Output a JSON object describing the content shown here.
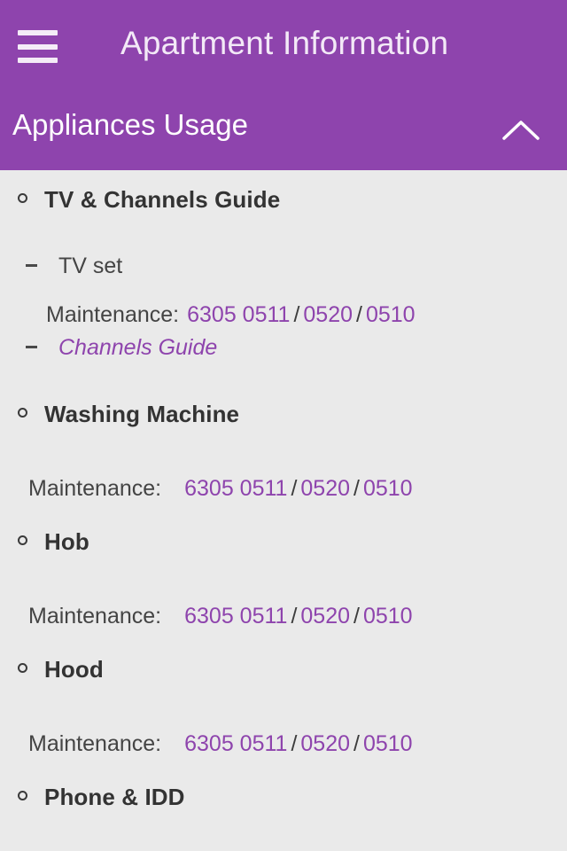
{
  "appbar": {
    "title": "Apartment Information",
    "menu_icon": "hamburger-menu-icon"
  },
  "section": {
    "label": "Appliances Usage",
    "expanded": true,
    "toggle_icon": "chevron-up-icon"
  },
  "colors": {
    "header_purple": "#8E44AD",
    "content_background": "#EAEAEA",
    "link_purple": "#8E44AD",
    "heading_text": "#333333",
    "body_text": "#444444"
  },
  "labels": {
    "maintenance": "Maintenance:",
    "separator": "/"
  },
  "appliances": [
    {
      "name": "TV & Channels Guide",
      "sub_items": [
        {
          "text": "TV set",
          "style": "plain"
        },
        {
          "text": "Channels Guide",
          "style": "link-italic"
        }
      ],
      "maintenance": {
        "label": "Maintenance:",
        "numbers": [
          "6305 0511",
          "0520",
          "0510"
        ]
      }
    },
    {
      "name": "Washing Machine",
      "sub_items": [],
      "maintenance": {
        "label": "Maintenance:",
        "numbers": [
          "6305 0511",
          "0520",
          "0510"
        ]
      }
    },
    {
      "name": "Hob",
      "sub_items": [],
      "maintenance": {
        "label": "Maintenance:",
        "numbers": [
          "6305 0511",
          "0520",
          "0510"
        ]
      }
    },
    {
      "name": "Hood",
      "sub_items": [],
      "maintenance": {
        "label": "Maintenance:",
        "numbers": [
          "6305 0511",
          "0520",
          "0510"
        ]
      }
    },
    {
      "name": "Phone & IDD",
      "sub_items": [],
      "maintenance": null
    }
  ]
}
